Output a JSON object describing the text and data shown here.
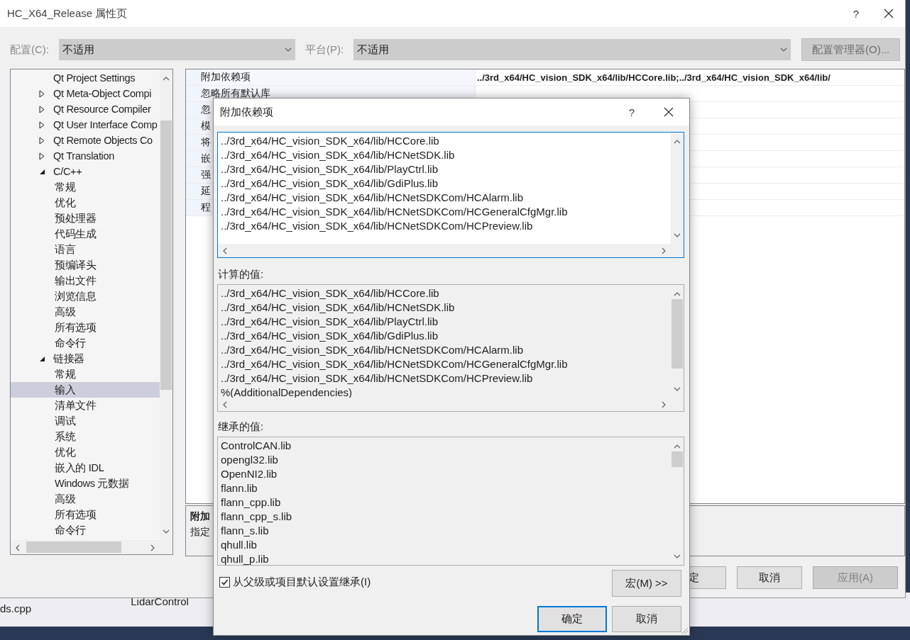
{
  "window": {
    "title": "HC_X64_Release 属性页",
    "help": "?"
  },
  "config_bar": {
    "configuration_label": "配置(C):",
    "configuration_value": "不适用",
    "platform_label": "平台(P):",
    "platform_value": "不适用",
    "manager_button": "配置管理器(O)...",
    "disabled": true
  },
  "tree": {
    "items": [
      {
        "label": "Qt Project Settings",
        "selected": false
      },
      {
        "label": "Qt Meta-Object Compi",
        "expanded": false,
        "selected": false
      },
      {
        "label": "Qt Resource Compiler",
        "expanded": false,
        "selected": false
      },
      {
        "label": "Qt User Interface Comp",
        "expanded": false,
        "selected": false
      },
      {
        "label": "Qt Remote Objects Co",
        "expanded": false,
        "selected": false
      },
      {
        "label": "Qt Translation",
        "expanded": false,
        "selected": false
      },
      {
        "label": "C/C++",
        "expanded": true,
        "selected": false,
        "children": [
          {
            "label": "常规",
            "selected": false
          },
          {
            "label": "优化",
            "selected": false
          },
          {
            "label": "预处理器",
            "selected": false
          },
          {
            "label": "代码生成",
            "selected": false
          },
          {
            "label": "语言",
            "selected": false
          },
          {
            "label": "预编译头",
            "selected": false
          },
          {
            "label": "输出文件",
            "selected": false
          },
          {
            "label": "浏览信息",
            "selected": false
          },
          {
            "label": "高级",
            "selected": false
          },
          {
            "label": "所有选项",
            "selected": false
          },
          {
            "label": "命令行",
            "selected": false
          }
        ]
      },
      {
        "label": "链接器",
        "expanded": true,
        "selected": false,
        "children": [
          {
            "label": "常规",
            "selected": false
          },
          {
            "label": "输入",
            "selected": true
          },
          {
            "label": "清单文件",
            "selected": false
          },
          {
            "label": "调试",
            "selected": false
          },
          {
            "label": "系统",
            "selected": false
          },
          {
            "label": "优化",
            "selected": false
          },
          {
            "label": "嵌入的 IDL",
            "selected": false
          },
          {
            "label": "Windows 元数据",
            "selected": false
          },
          {
            "label": "高级",
            "selected": false
          },
          {
            "label": "所有选项",
            "selected": false
          },
          {
            "label": "命令行",
            "selected": false
          }
        ]
      }
    ]
  },
  "property_grid": {
    "rows": [
      {
        "name": "附加依赖项",
        "value": "../3rd_x64/HC_vision_SDK_x64/lib/HCCore.lib;../3rd_x64/HC_vision_SDK_x64/lib/"
      },
      {
        "name": "忽略所有默认库"
      },
      {
        "name": "忽"
      },
      {
        "name": "模"
      },
      {
        "name": "将"
      },
      {
        "name": "嵌"
      },
      {
        "name": "强"
      },
      {
        "name": "延"
      },
      {
        "name": "程"
      }
    ]
  },
  "description": {
    "title": "附加",
    "text": "指定"
  },
  "buttons": [
    {
      "label": "定",
      "disabled": false
    },
    {
      "label": "取消",
      "disabled": false
    },
    {
      "label": "应用(A)",
      "disabled": true
    }
  ],
  "background": {
    "file": "ds.cpp",
    "tab": "LidarControl"
  },
  "dialog": {
    "title": "附加依赖项",
    "help": "?",
    "edit_lines": [
      "../3rd_x64/HC_vision_SDK_x64/lib/HCCore.lib",
      "../3rd_x64/HC_vision_SDK_x64/lib/HCNetSDK.lib",
      "../3rd_x64/HC_vision_SDK_x64/lib/PlayCtrl.lib",
      "../3rd_x64/HC_vision_SDK_x64/lib/GdiPlus.lib",
      "../3rd_x64/HC_vision_SDK_x64/lib/HCNetSDKCom/HCAlarm.lib",
      "../3rd_x64/HC_vision_SDK_x64/lib/HCNetSDKCom/HCGeneralCfgMgr.lib",
      "../3rd_x64/HC_vision_SDK_x64/lib/HCNetSDKCom/HCPreview.lib"
    ],
    "computed_label": "计算的值:",
    "computed_lines": [
      "../3rd_x64/HC_vision_SDK_x64/lib/HCCore.lib",
      "../3rd_x64/HC_vision_SDK_x64/lib/HCNetSDK.lib",
      "../3rd_x64/HC_vision_SDK_x64/lib/PlayCtrl.lib",
      "../3rd_x64/HC_vision_SDK_x64/lib/GdiPlus.lib",
      "../3rd_x64/HC_vision_SDK_x64/lib/HCNetSDKCom/HCAlarm.lib",
      "../3rd_x64/HC_vision_SDK_x64/lib/HCNetSDKCom/HCGeneralCfgMgr.lib",
      "../3rd_x64/HC_vision_SDK_x64/lib/HCNetSDKCom/HCPreview.lib",
      "%(AdditionalDependencies)"
    ],
    "inherited_label": "继承的值:",
    "inherited_lines": [
      "ControlCAN.lib",
      "opengl32.lib",
      "OpenNI2.lib",
      "flann.lib",
      "flann_cpp.lib",
      "flann_cpp_s.lib",
      "flann_s.lib",
      "qhull.lib",
      "qhull_p.lib"
    ],
    "inherit_checkbox": {
      "label": "从父级或项目默认设置继承(I)",
      "checked": true
    },
    "macros_button": "宏(M) >>",
    "ok_button": "确定",
    "cancel_button": "取消"
  }
}
